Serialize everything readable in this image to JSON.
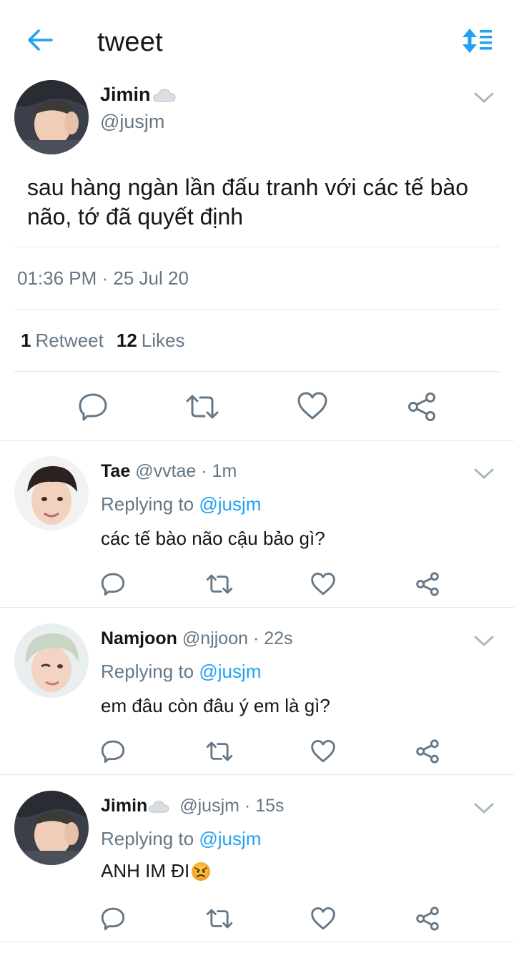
{
  "header": {
    "title": "tweet",
    "back_icon": "arrow-left-icon",
    "sort_icon": "sort-toggle-icon",
    "accent": "#1da1f2"
  },
  "tweet": {
    "name": "Jimin",
    "name_emoji": "cloud-emoji",
    "handle": "@jusjm",
    "text": "sau hàng ngàn lần đấu tranh với các tế bào não, tớ đã quyết định",
    "timestamp": "01:36 PM · 25 Jul 20",
    "retweet_count": "1",
    "retweet_label": "Retweet",
    "like_count": "12",
    "like_label": "Likes"
  },
  "replies": [
    {
      "name": "Tae",
      "handle": "@vvtae",
      "time": "· 1m",
      "replying_label": "Replying to",
      "replying_to": "@jusjm",
      "text": "các tế bào não cậu bảo gì?"
    },
    {
      "name": "Namjoon",
      "handle": "@njjoon",
      "time": "· 22s",
      "replying_label": "Replying to",
      "replying_to": "@jusjm",
      "text": "em đâu còn đâu ý em là gì?"
    },
    {
      "name": "Jimin",
      "name_emoji": "cloud-emoji",
      "handle": "@jusjm",
      "time": "· 15s",
      "replying_label": "Replying to",
      "replying_to": "@jusjm",
      "text": "ANH IM ĐI",
      "text_emoji": "angry-face-emoji"
    }
  ],
  "colors": {
    "text_primary": "#14171a",
    "text_secondary": "#657786",
    "divider": "#e1e8ed",
    "icon_gray": "#657786"
  }
}
